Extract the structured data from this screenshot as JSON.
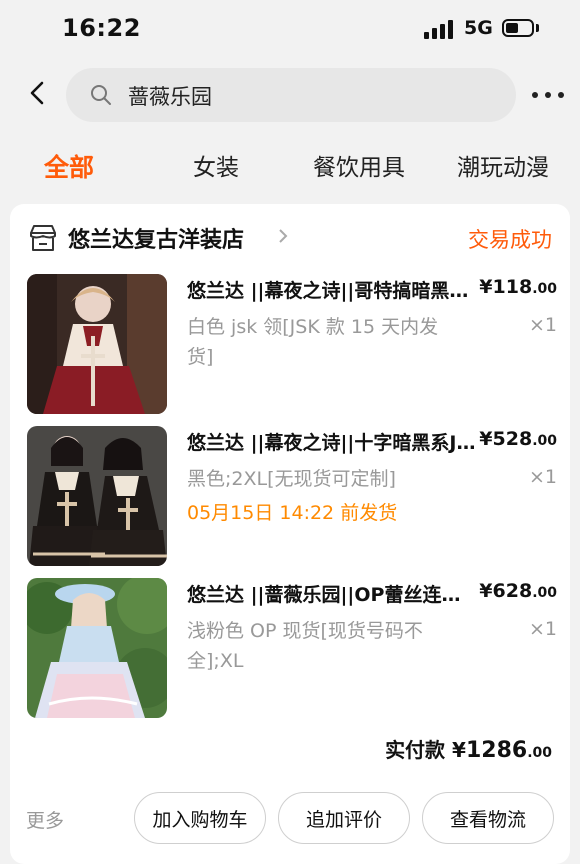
{
  "status_bar": {
    "time": "16:22",
    "network": "5G"
  },
  "header": {
    "search_text": "蔷薇乐园"
  },
  "tabs": [
    {
      "label": "全部",
      "active": true
    },
    {
      "label": "女装"
    },
    {
      "label": "餐饮用具"
    },
    {
      "label": "潮玩动漫"
    }
  ],
  "order": {
    "shop_name": "悠兰达复古洋装店",
    "status": "交易成功",
    "items": [
      {
        "title": "悠兰达 ||幕夜之诗||哥特搞暗黑系JSK",
        "sku_line1": "白色 jsk 领[JSK 款 15 天内发",
        "sku_line2": "货]",
        "price_main": "118",
        "price_dec": ".00",
        "currency": "¥",
        "qty": "×1"
      },
      {
        "title": "悠兰达 ||幕夜之诗||十字暗黑系JSK",
        "sku_line1": "黑色;2XL[无现货可定制]",
        "shipnote": "05月15日 14:22 前发货",
        "price_main": "528",
        "price_dec": ".00",
        "currency": "¥",
        "qty": "×1"
      },
      {
        "title": "悠兰达 ||蔷薇乐园||OP蕾丝连衣裙",
        "sku_line1": "浅粉色 OP 现货[现货号码不",
        "sku_line2": "全];XL",
        "price_main": "628",
        "price_dec": ".00",
        "currency": "¥",
        "qty": "×1"
      }
    ],
    "total": {
      "label": "实付款",
      "currency": "¥",
      "amount_main": "1286",
      "amount_dec": ".00"
    }
  },
  "actions": {
    "more": "更多",
    "add_cart": "加入购物车",
    "add_review": "追加评价",
    "view_logistics": "查看物流"
  },
  "colors": {
    "accent": "#ff5b0a",
    "shipnote": "#ff8a00",
    "muted": "#999999"
  }
}
